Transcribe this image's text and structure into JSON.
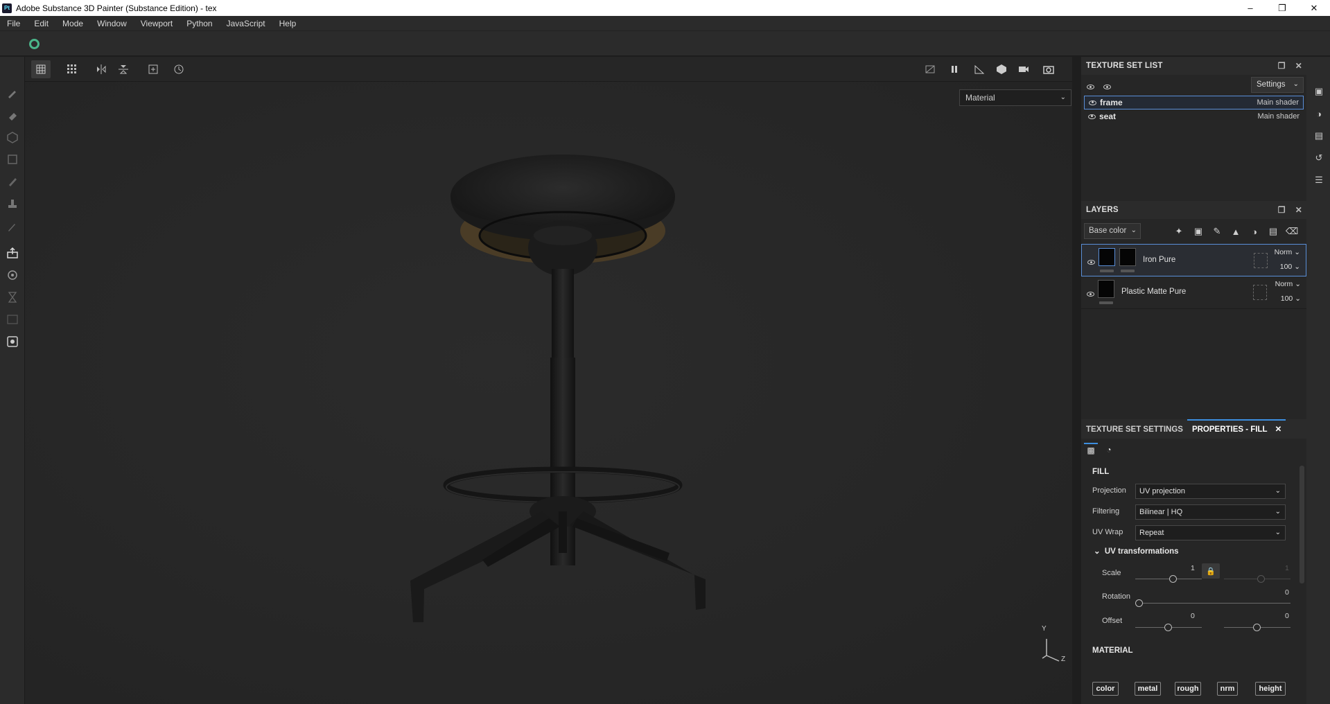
{
  "window": {
    "app_icon": "Pt",
    "title": "Adobe Substance 3D Painter (Substance Edition) - tex",
    "minimize": "–",
    "maximize": "❐",
    "close": "✕"
  },
  "menu": [
    "File",
    "Edit",
    "Mode",
    "Window",
    "Viewport",
    "Python",
    "JavaScript",
    "Help"
  ],
  "viewport": {
    "display_mode": "Material",
    "axis_labels": {
      "y": "Y",
      "z": "Z"
    }
  },
  "texture_set_list": {
    "title": "TEXTURE SET LIST",
    "settings_label": "Settings",
    "items": [
      {
        "name": "frame",
        "shader": "Main shader",
        "selected": true
      },
      {
        "name": "seat",
        "shader": "Main shader",
        "selected": false
      }
    ]
  },
  "layers": {
    "title": "LAYERS",
    "channel": "Base color",
    "items": [
      {
        "name": "Iron Pure",
        "blend": "Norm",
        "opacity": "100",
        "selected": true
      },
      {
        "name": "Plastic Matte Pure",
        "blend": "Norm",
        "opacity": "100",
        "selected": false
      }
    ]
  },
  "properties": {
    "tabs": [
      "TEXTURE SET SETTINGS",
      "PROPERTIES - FILL"
    ],
    "active_tab": "PROPERTIES - FILL",
    "fill": {
      "title": "FILL",
      "projection_label": "Projection",
      "projection_value": "UV projection",
      "filtering_label": "Filtering",
      "filtering_value": "Bilinear | HQ",
      "uvwrap_label": "UV Wrap",
      "uvwrap_value": "Repeat"
    },
    "uv": {
      "title": "UV transformations",
      "scale_label": "Scale",
      "scale_u": "1",
      "scale_v": "1",
      "rotation_label": "Rotation",
      "rotation_value": "0",
      "offset_label": "Offset",
      "offset_u": "0",
      "offset_v": "0"
    },
    "material": {
      "title": "MATERIAL",
      "channels": [
        "color",
        "metal",
        "rough",
        "nrm",
        "height"
      ]
    }
  }
}
